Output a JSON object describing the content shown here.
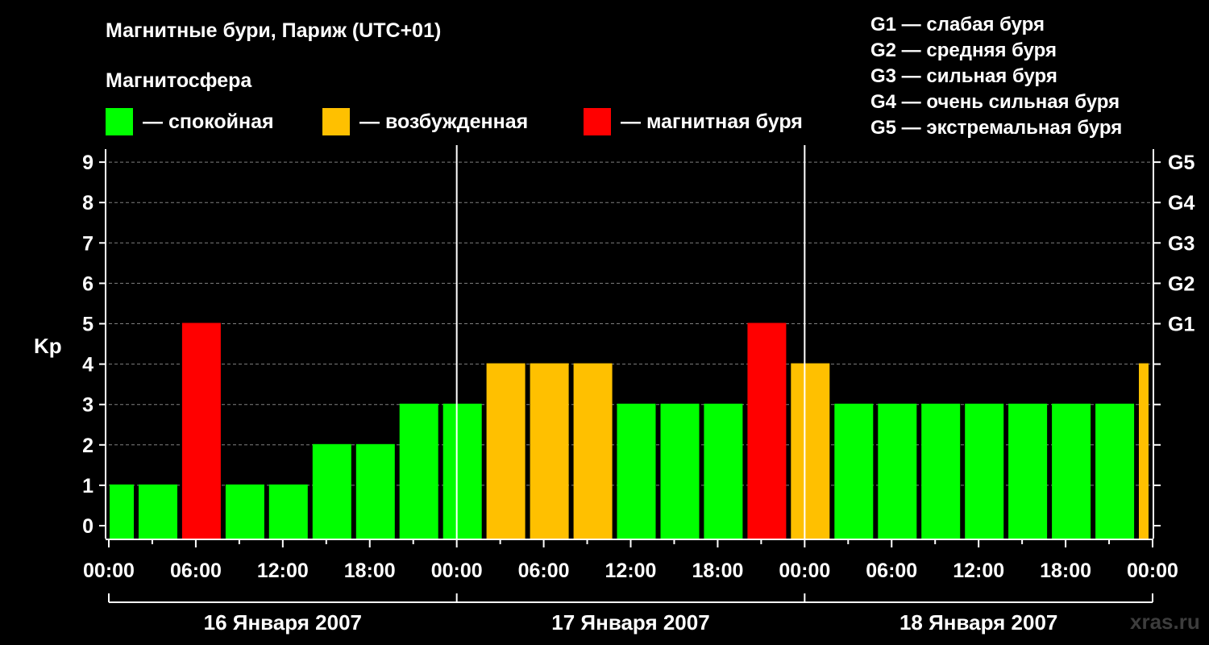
{
  "title": "Магнитные бури, Париж (UTC+01)",
  "subtitle": "Магнитосфера",
  "legend": [
    {
      "label": "— спокойная",
      "color": "#00ff00"
    },
    {
      "label": "— возбужденная",
      "color": "#ffc000"
    },
    {
      "label": "— магнитная буря",
      "color": "#ff0000"
    }
  ],
  "g_legend": [
    "G1 — слабая буря",
    "G2 — средняя буря",
    "G3 — сильная буря",
    "G4 — очень сильная буря",
    "G5 — экстремальная буря"
  ],
  "watermark": "xras.ru",
  "chart_data": {
    "type": "bar",
    "ylabel": "Kp",
    "ylim": [
      0,
      9
    ],
    "yticks": [
      "0",
      "1",
      "2",
      "3",
      "4",
      "5",
      "6",
      "7",
      "8",
      "9"
    ],
    "right_ticks": [
      {
        "kp": 5,
        "label": "G1"
      },
      {
        "kp": 6,
        "label": "G2"
      },
      {
        "kp": 7,
        "label": "G3"
      },
      {
        "kp": 8,
        "label": "G4"
      },
      {
        "kp": 9,
        "label": "G5"
      }
    ],
    "grid": "dashed horizontal",
    "xticks": [
      "00:00",
      "06:00",
      "12:00",
      "18:00",
      "00:00",
      "06:00",
      "12:00",
      "18:00",
      "00:00",
      "06:00",
      "12:00",
      "18:00",
      "00:00"
    ],
    "days": [
      "16 Января 2007",
      "17 Января 2007",
      "18 Января 2007"
    ],
    "color_scale": {
      "quiet": "#00ff00",
      "active": "#ffc000",
      "storm": "#ff0000"
    },
    "bars": [
      {
        "start_hour": -1,
        "kp": 1,
        "level": "quiet"
      },
      {
        "start_hour": 2,
        "kp": 1,
        "level": "quiet"
      },
      {
        "start_hour": 5,
        "kp": 5,
        "level": "storm"
      },
      {
        "start_hour": 8,
        "kp": 1,
        "level": "quiet"
      },
      {
        "start_hour": 11,
        "kp": 1,
        "level": "quiet"
      },
      {
        "start_hour": 14,
        "kp": 2,
        "level": "quiet"
      },
      {
        "start_hour": 17,
        "kp": 2,
        "level": "quiet"
      },
      {
        "start_hour": 20,
        "kp": 3,
        "level": "quiet"
      },
      {
        "start_hour": 23,
        "kp": 3,
        "level": "quiet"
      },
      {
        "start_hour": 26,
        "kp": 4,
        "level": "active"
      },
      {
        "start_hour": 29,
        "kp": 4,
        "level": "active"
      },
      {
        "start_hour": 32,
        "kp": 4,
        "level": "active"
      },
      {
        "start_hour": 35,
        "kp": 3,
        "level": "quiet"
      },
      {
        "start_hour": 38,
        "kp": 3,
        "level": "quiet"
      },
      {
        "start_hour": 41,
        "kp": 3,
        "level": "quiet"
      },
      {
        "start_hour": 44,
        "kp": 5,
        "level": "storm"
      },
      {
        "start_hour": 47,
        "kp": 4,
        "level": "active"
      },
      {
        "start_hour": 50,
        "kp": 3,
        "level": "quiet"
      },
      {
        "start_hour": 53,
        "kp": 3,
        "level": "quiet"
      },
      {
        "start_hour": 56,
        "kp": 3,
        "level": "quiet"
      },
      {
        "start_hour": 59,
        "kp": 3,
        "level": "quiet"
      },
      {
        "start_hour": 62,
        "kp": 3,
        "level": "quiet"
      },
      {
        "start_hour": 65,
        "kp": 3,
        "level": "quiet"
      },
      {
        "start_hour": 68,
        "kp": 3,
        "level": "quiet"
      },
      {
        "start_hour": 71,
        "kp": 4,
        "level": "active"
      }
    ]
  }
}
